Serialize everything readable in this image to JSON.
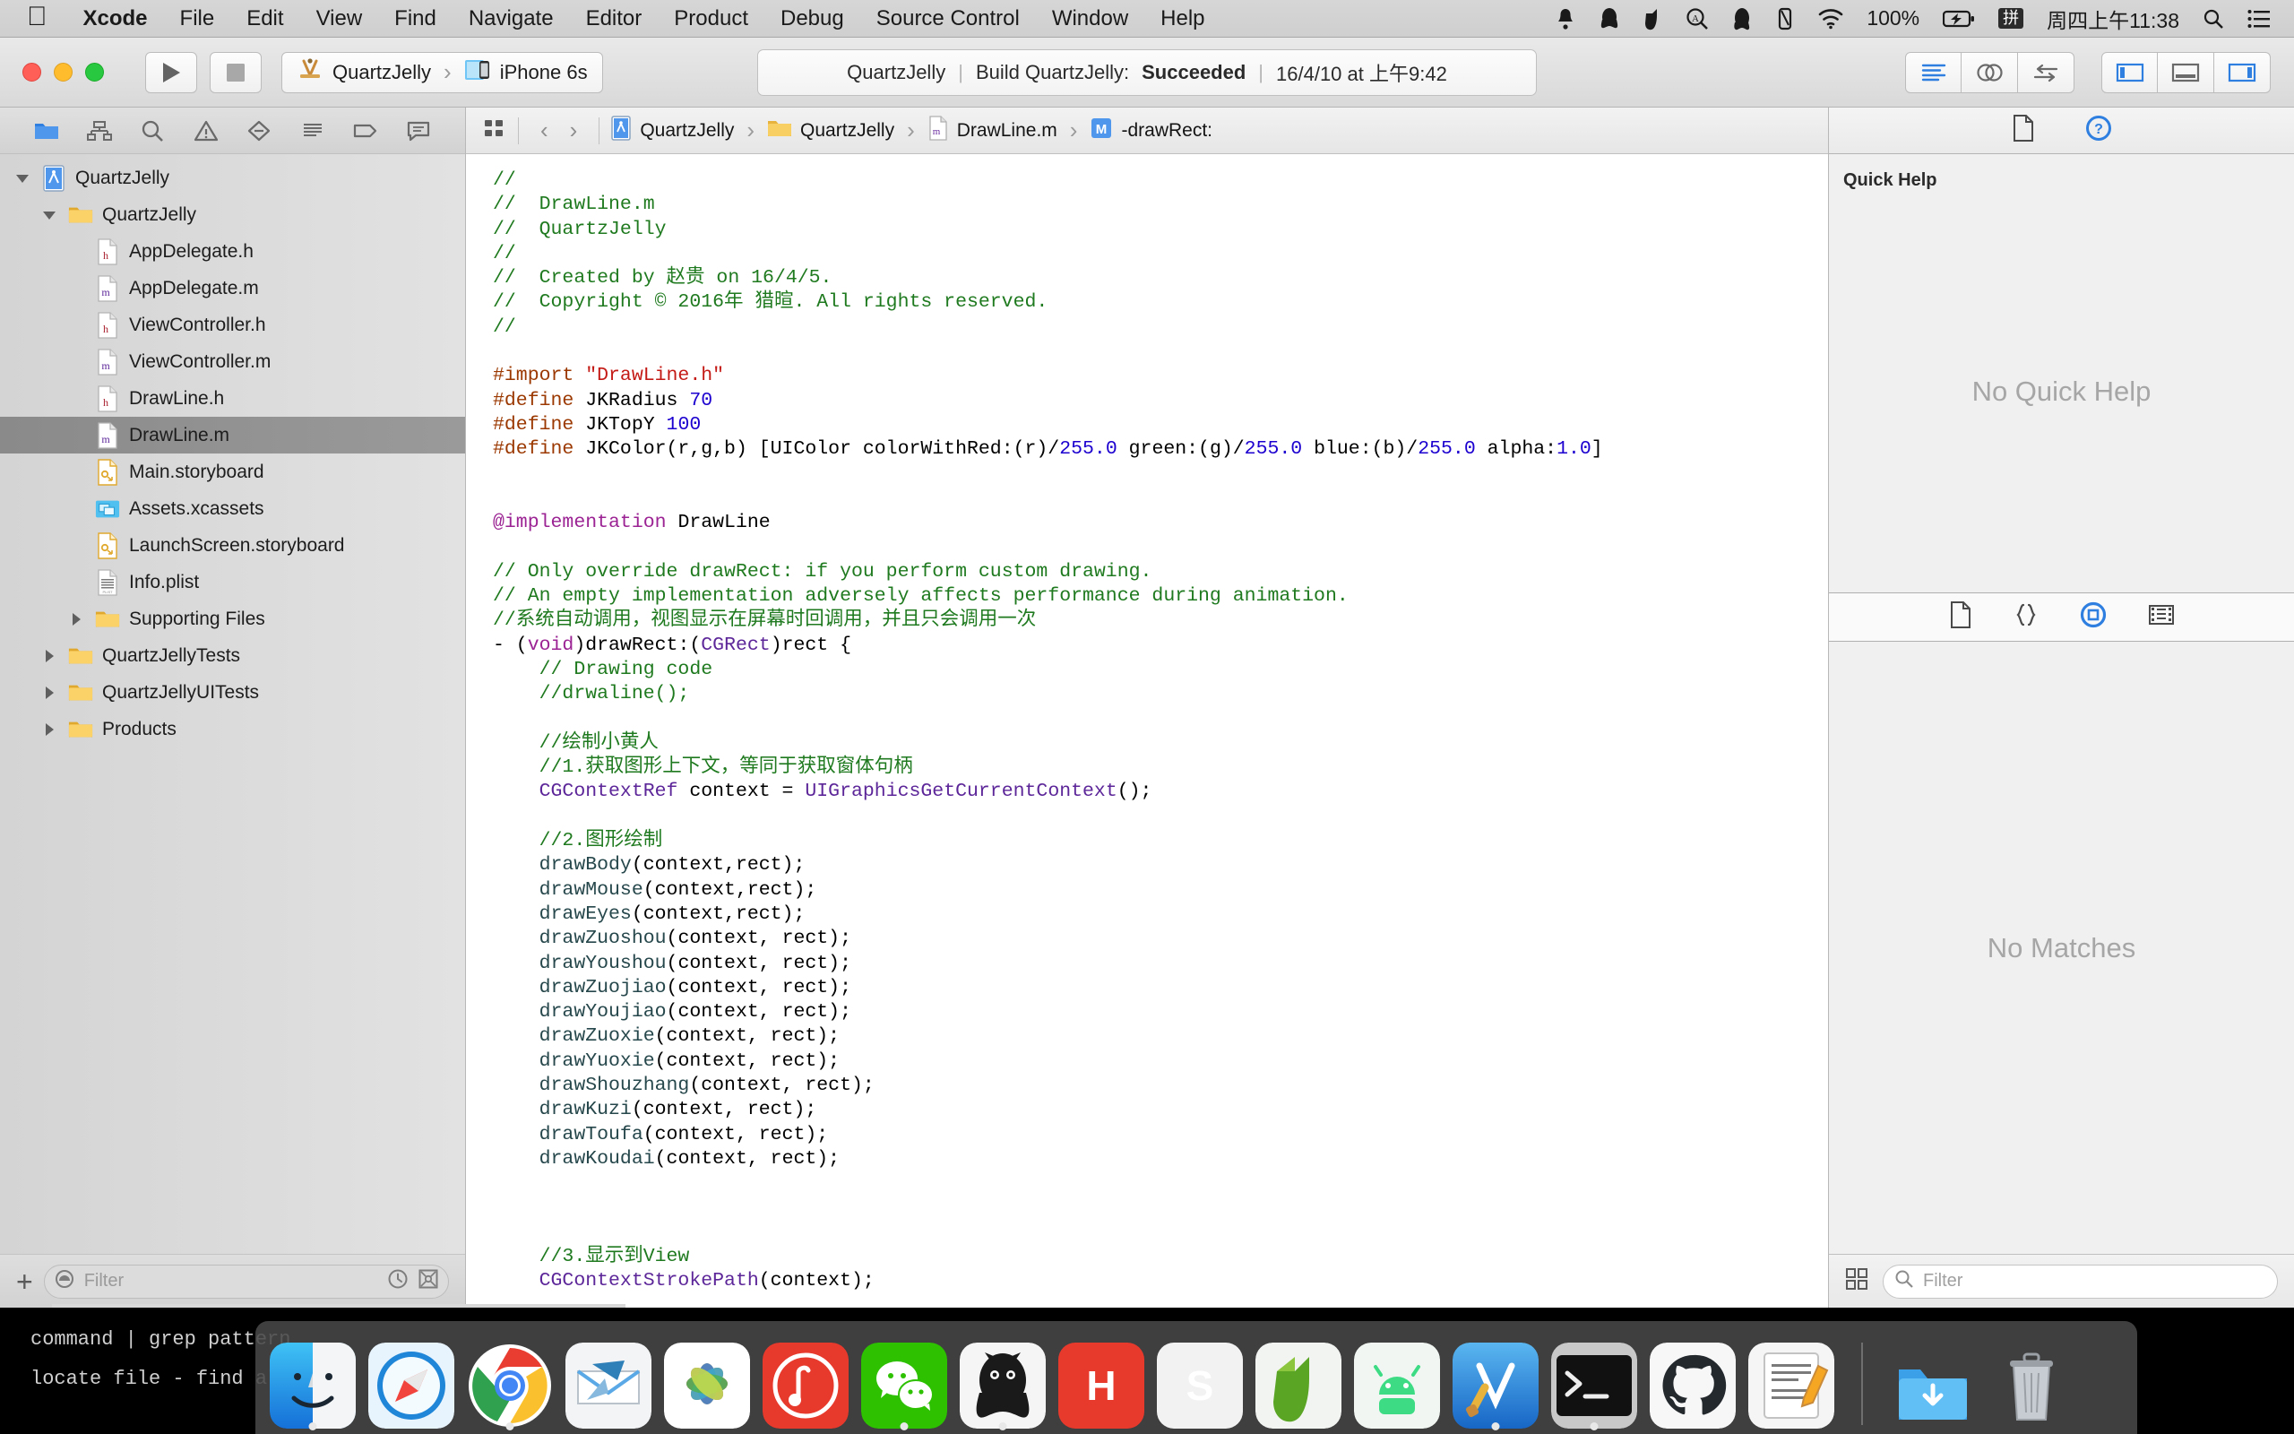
{
  "menubar": {
    "apple_icon": "apple-logo",
    "items": [
      {
        "label": "Xcode",
        "bold": true
      },
      {
        "label": "File",
        "bold": false
      },
      {
        "label": "Edit",
        "bold": false
      },
      {
        "label": "View",
        "bold": false
      },
      {
        "label": "Find",
        "bold": false
      },
      {
        "label": "Navigate",
        "bold": false
      },
      {
        "label": "Editor",
        "bold": false
      },
      {
        "label": "Product",
        "bold": false
      },
      {
        "label": "Debug",
        "bold": false
      },
      {
        "label": "Source Control",
        "bold": false
      },
      {
        "label": "Window",
        "bold": false
      },
      {
        "label": "Help",
        "bold": false
      }
    ],
    "status_icons": [
      "bell-icon",
      "qq-icon",
      "evernote-icon",
      "alfred-icon",
      "penguin-icon",
      "airplay-icon",
      "wifi-icon"
    ],
    "battery_percent": "100%",
    "battery_icon": "battery-charging-icon",
    "input_method": "拼",
    "clock": "周四上午11:38",
    "spotlight_icon": "search-icon",
    "notification_icon": "notification-center-icon"
  },
  "toolbar": {
    "run_icon": "play-icon",
    "stop_icon": "stop-icon",
    "scheme_project": "QuartzJelly",
    "scheme_device": "iPhone 6s",
    "scheme_project_icon": "xcode-scheme-icon",
    "scheme_device_icon": "iphone-simulator-icon",
    "status": {
      "project": "QuartzJelly",
      "action": "Build QuartzJelly:",
      "result": "Succeeded",
      "timestamp": "16/4/10 at 上午9:42"
    },
    "editor_modes": [
      "standard-editor-icon",
      "assistant-editor-icon",
      "version-editor-icon"
    ],
    "view_toggles": [
      "navigator-toggle-icon",
      "debug-area-toggle-icon",
      "utilities-toggle-icon"
    ]
  },
  "navigator": {
    "tabs": [
      "project-navigator-icon",
      "symbol-navigator-icon",
      "find-navigator-icon",
      "issue-navigator-icon",
      "test-navigator-icon",
      "debug-navigator-icon",
      "breakpoint-navigator-icon",
      "report-navigator-icon"
    ],
    "active_tab_index": 0,
    "tree": [
      {
        "label": "QuartzJelly",
        "indent": 0,
        "icon": "xcodeproj-icon",
        "twisty": "down",
        "selected": false
      },
      {
        "label": "QuartzJelly",
        "indent": 1,
        "icon": "folder-icon",
        "twisty": "down",
        "selected": false
      },
      {
        "label": "AppDelegate.h",
        "indent": 2,
        "icon": "header-file-icon",
        "twisty": "none",
        "selected": false
      },
      {
        "label": "AppDelegate.m",
        "indent": 2,
        "icon": "source-file-icon",
        "twisty": "none",
        "selected": false
      },
      {
        "label": "ViewController.h",
        "indent": 2,
        "icon": "header-file-icon",
        "twisty": "none",
        "selected": false
      },
      {
        "label": "ViewController.m",
        "indent": 2,
        "icon": "source-file-icon",
        "twisty": "none",
        "selected": false
      },
      {
        "label": "DrawLine.h",
        "indent": 2,
        "icon": "header-file-icon",
        "twisty": "none",
        "selected": false
      },
      {
        "label": "DrawLine.m",
        "indent": 2,
        "icon": "source-file-icon",
        "twisty": "none",
        "selected": true
      },
      {
        "label": "Main.storyboard",
        "indent": 2,
        "icon": "storyboard-icon",
        "twisty": "none",
        "selected": false
      },
      {
        "label": "Assets.xcassets",
        "indent": 2,
        "icon": "assets-icon",
        "twisty": "none",
        "selected": false
      },
      {
        "label": "LaunchScreen.storyboard",
        "indent": 2,
        "icon": "storyboard-icon",
        "twisty": "none",
        "selected": false
      },
      {
        "label": "Info.plist",
        "indent": 2,
        "icon": "plist-icon",
        "twisty": "none",
        "selected": false
      },
      {
        "label": "Supporting Files",
        "indent": 2,
        "icon": "folder-icon",
        "twisty": "right",
        "selected": false
      },
      {
        "label": "QuartzJellyTests",
        "indent": 1,
        "icon": "folder-icon",
        "twisty": "right",
        "selected": false
      },
      {
        "label": "QuartzJellyUITests",
        "indent": 1,
        "icon": "folder-icon",
        "twisty": "right",
        "selected": false
      },
      {
        "label": "Products",
        "indent": 1,
        "icon": "folder-icon",
        "twisty": "right",
        "selected": false
      }
    ],
    "add_button": "+",
    "filter_placeholder": "Filter",
    "filter_value": "",
    "filter_left_icon": "recent-filter-icon",
    "filter_right_icons": [
      "clock-icon",
      "source-control-filter-icon"
    ]
  },
  "jumpbar": {
    "related_items_icon": "related-items-icon",
    "back_icon": "chevron-left-icon",
    "forward_icon": "chevron-right-icon",
    "crumbs": [
      {
        "label": "QuartzJelly",
        "icon": "xcodeproj-icon"
      },
      {
        "label": "QuartzJelly",
        "icon": "folder-icon"
      },
      {
        "label": "DrawLine.m",
        "icon": "source-file-icon"
      },
      {
        "label": "-drawRect:",
        "icon": "method-icon"
      }
    ]
  },
  "code": {
    "lines": [
      [
        {
          "t": "//",
          "c": "cm"
        }
      ],
      [
        {
          "t": "//  DrawLine.m",
          "c": "cm"
        }
      ],
      [
        {
          "t": "//  QuartzJelly",
          "c": "cm"
        }
      ],
      [
        {
          "t": "//",
          "c": "cm"
        }
      ],
      [
        {
          "t": "//  Created by 赵贵 on 16/4/5.",
          "c": "cm"
        }
      ],
      [
        {
          "t": "//  Copyright © 2016年 猎暄. All rights reserved.",
          "c": "cm"
        }
      ],
      [
        {
          "t": "//",
          "c": "cm"
        }
      ],
      [],
      [
        {
          "t": "#import ",
          "c": "pp"
        },
        {
          "t": "\"DrawLine.h\"",
          "c": "str"
        }
      ],
      [
        {
          "t": "#define ",
          "c": "pp"
        },
        {
          "t": "JKRadius ",
          "c": "pl"
        },
        {
          "t": "70",
          "c": "num"
        }
      ],
      [
        {
          "t": "#define ",
          "c": "pp"
        },
        {
          "t": "JKTopY ",
          "c": "pl"
        },
        {
          "t": "100",
          "c": "num"
        }
      ],
      [
        {
          "t": "#define ",
          "c": "pp"
        },
        {
          "t": "JKColor(r,g,b) [UIColor colorWithRed:(r)/",
          "c": "pl"
        },
        {
          "t": "255.0",
          "c": "num"
        },
        {
          "t": " green:(g)/",
          "c": "pl"
        },
        {
          "t": "255.0",
          "c": "num"
        },
        {
          "t": " blue:(b)/",
          "c": "pl"
        },
        {
          "t": "255.0",
          "c": "num"
        },
        {
          "t": " alpha:",
          "c": "pl"
        },
        {
          "t": "1.0",
          "c": "num"
        },
        {
          "t": "]",
          "c": "pl"
        }
      ],
      [],
      [],
      [
        {
          "t": "@implementation",
          "c": "kw"
        },
        {
          "t": " DrawLine",
          "c": "pl"
        }
      ],
      [],
      [
        {
          "t": "// Only override drawRect: if you perform custom drawing.",
          "c": "cm"
        }
      ],
      [
        {
          "t": "// An empty implementation adversely affects performance during animation.",
          "c": "cm"
        }
      ],
      [
        {
          "t": "//系统自动调用，视图显示在屏幕时回调用，并且只会调用一次",
          "c": "cm"
        }
      ],
      [
        {
          "t": "- (",
          "c": "pl"
        },
        {
          "t": "void",
          "c": "kw"
        },
        {
          "t": ")drawRect:(",
          "c": "pl"
        },
        {
          "t": "CGRect",
          "c": "ty"
        },
        {
          "t": ")rect {",
          "c": "pl"
        }
      ],
      [
        {
          "t": "    // Drawing code",
          "c": "cm"
        }
      ],
      [
        {
          "t": "    //drwaline();",
          "c": "cm"
        }
      ],
      [],
      [
        {
          "t": "    //绘制小黄人",
          "c": "cm"
        }
      ],
      [
        {
          "t": "    //1.获取图形上下文，等同于获取窗体句柄",
          "c": "cm"
        }
      ],
      [
        {
          "t": "    ",
          "c": "pl"
        },
        {
          "t": "CGContextRef",
          "c": "ty"
        },
        {
          "t": " context = ",
          "c": "pl"
        },
        {
          "t": "UIGraphicsGetCurrentContext",
          "c": "ty"
        },
        {
          "t": "();",
          "c": "pl"
        }
      ],
      [],
      [
        {
          "t": "    //2.图形绘制",
          "c": "cm"
        }
      ],
      [
        {
          "t": "    ",
          "c": "pl"
        },
        {
          "t": "drawBody",
          "c": "fn"
        },
        {
          "t": "(context,rect);",
          "c": "pl"
        }
      ],
      [
        {
          "t": "    ",
          "c": "pl"
        },
        {
          "t": "drawMouse",
          "c": "fn"
        },
        {
          "t": "(context,rect);",
          "c": "pl"
        }
      ],
      [
        {
          "t": "    ",
          "c": "pl"
        },
        {
          "t": "drawEyes",
          "c": "fn"
        },
        {
          "t": "(context,rect);",
          "c": "pl"
        }
      ],
      [
        {
          "t": "    ",
          "c": "pl"
        },
        {
          "t": "drawZuoshou",
          "c": "fn"
        },
        {
          "t": "(context, rect);",
          "c": "pl"
        }
      ],
      [
        {
          "t": "    ",
          "c": "pl"
        },
        {
          "t": "drawYoushou",
          "c": "fn"
        },
        {
          "t": "(context, rect);",
          "c": "pl"
        }
      ],
      [
        {
          "t": "    ",
          "c": "pl"
        },
        {
          "t": "drawZuojiao",
          "c": "fn"
        },
        {
          "t": "(context, rect);",
          "c": "pl"
        }
      ],
      [
        {
          "t": "    ",
          "c": "pl"
        },
        {
          "t": "drawYoujiao",
          "c": "fn"
        },
        {
          "t": "(context, rect);",
          "c": "pl"
        }
      ],
      [
        {
          "t": "    ",
          "c": "pl"
        },
        {
          "t": "drawZuoxie",
          "c": "fn"
        },
        {
          "t": "(context, rect);",
          "c": "pl"
        }
      ],
      [
        {
          "t": "    ",
          "c": "pl"
        },
        {
          "t": "drawYuoxie",
          "c": "fn"
        },
        {
          "t": "(context, rect);",
          "c": "pl"
        }
      ],
      [
        {
          "t": "    ",
          "c": "pl"
        },
        {
          "t": "drawShouzhang",
          "c": "fn"
        },
        {
          "t": "(context, rect);",
          "c": "pl"
        }
      ],
      [
        {
          "t": "    ",
          "c": "pl"
        },
        {
          "t": "drawKuzi",
          "c": "fn"
        },
        {
          "t": "(context, rect);",
          "c": "pl"
        }
      ],
      [
        {
          "t": "    ",
          "c": "pl"
        },
        {
          "t": "drawToufa",
          "c": "fn"
        },
        {
          "t": "(context, rect);",
          "c": "pl"
        }
      ],
      [
        {
          "t": "    ",
          "c": "pl"
        },
        {
          "t": "drawKoudai",
          "c": "fn"
        },
        {
          "t": "(context, rect);",
          "c": "pl"
        }
      ],
      [],
      [],
      [],
      [
        {
          "t": "    //3.显示到View",
          "c": "cm"
        }
      ],
      [
        {
          "t": "    ",
          "c": "pl"
        },
        {
          "t": "CGContextStrokePath",
          "c": "ty"
        },
        {
          "t": "(context);",
          "c": "pl"
        }
      ],
      [],
      [
        {
          "t": "}",
          "c": "pl"
        }
      ]
    ]
  },
  "inspector": {
    "tabs": [
      "file-inspector-icon",
      "quick-help-inspector-icon"
    ],
    "active_tab_index": 1,
    "quick_help_title": "Quick Help",
    "quick_help_empty": "No Quick Help",
    "library_tabs": [
      "file-template-library-icon",
      "code-snippet-library-icon",
      "object-library-icon",
      "media-library-icon"
    ],
    "library_active_index": 2,
    "library_empty": "No Matches",
    "library_grid_icon": "grid-view-icon",
    "library_filter_placeholder": "Filter",
    "library_filter_value": "",
    "library_filter_icon": "search-icon"
  },
  "terminal": {
    "lines": [
      "command | grep pattern",
      "locate file - find all"
    ]
  },
  "dock": {
    "items": [
      {
        "name": "finder-dock-icon",
        "label": "",
        "bg": "#2196f3",
        "running": true
      },
      {
        "name": "safari-dock-icon",
        "label": "",
        "bg": "#1f6fd0",
        "running": false
      },
      {
        "name": "chrome-dock-icon",
        "label": "",
        "bg": "#ffffff",
        "running": true
      },
      {
        "name": "mail-dock-icon",
        "label": "",
        "bg": "#f2f2f2",
        "running": false
      },
      {
        "name": "photos-dock-icon",
        "label": "",
        "bg": "#ffffff",
        "running": false
      },
      {
        "name": "netease-music-dock-icon",
        "label": "",
        "bg": "#e8392d",
        "running": false
      },
      {
        "name": "wechat-dock-icon",
        "label": "",
        "bg": "#2dc100",
        "running": true
      },
      {
        "name": "qq-dock-icon",
        "label": "",
        "bg": "#1a1a1a",
        "running": true
      },
      {
        "name": "highlight-dock-icon",
        "label": "H",
        "bg": "#e8392d",
        "running": false
      },
      {
        "name": "sublime-dock-icon",
        "label": "S",
        "bg": "#f2f2f2",
        "running": false
      },
      {
        "name": "evernote-dock-icon",
        "label": "",
        "bg": "#5ba525",
        "running": false
      },
      {
        "name": "android-studio-dock-icon",
        "label": "",
        "bg": "#3ddc84",
        "running": false
      },
      {
        "name": "xcode-dock-icon",
        "label": "",
        "bg": "#1e90e0",
        "running": true
      },
      {
        "name": "terminal-dock-icon",
        "label": "",
        "bg": "#1a1a1a",
        "running": true
      },
      {
        "name": "github-desktop-dock-icon",
        "label": "",
        "bg": "#f2f2f2",
        "running": false
      },
      {
        "name": "pages-dock-icon",
        "label": "",
        "bg": "#f5a623",
        "running": false
      },
      {
        "name": "downloads-stack-icon",
        "label": "",
        "bg": "#3ba0e8",
        "running": false
      },
      {
        "name": "trash-dock-icon",
        "label": "",
        "bg": "#9aa0a5",
        "running": false
      }
    ],
    "separator_after_index": 15
  }
}
